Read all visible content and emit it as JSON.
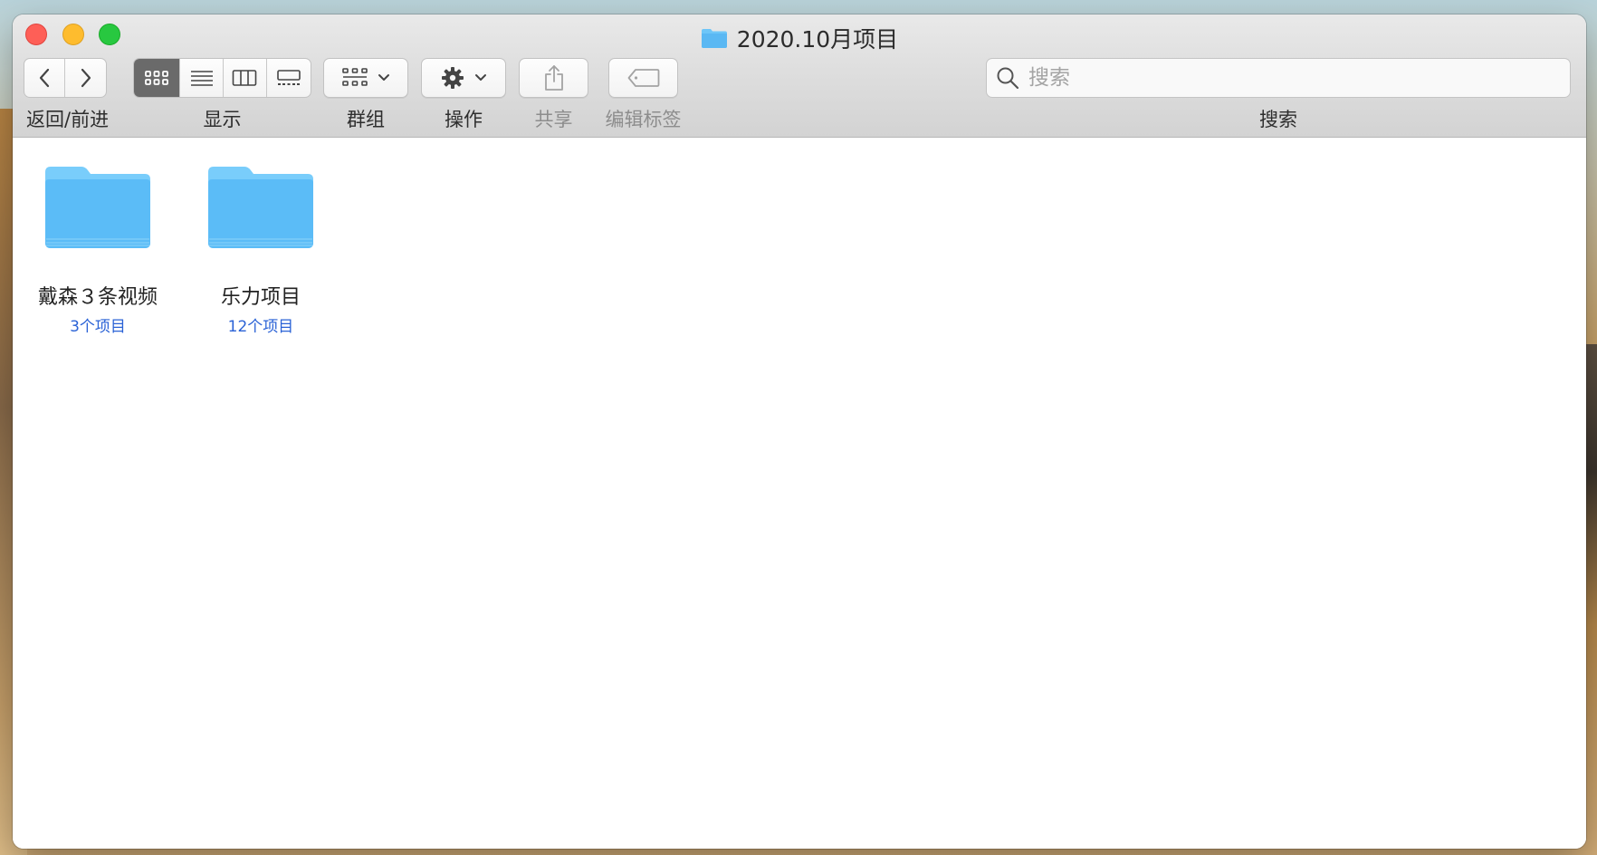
{
  "window": {
    "title": "2020.10月项目",
    "title_icon": "folder-icon"
  },
  "toolbar": {
    "back_forward_label": "返回/前进",
    "view_label": "显示",
    "group_label": "群组",
    "action_label": "操作",
    "share_label": "共享",
    "tags_label": "编辑标签",
    "search_label": "搜索",
    "search_placeholder": "搜索",
    "active_view": "icon-view"
  },
  "items": [
    {
      "name": "戴森３条视频",
      "count": "3个项目"
    },
    {
      "name": "乐力项目",
      "count": "12个项目"
    }
  ],
  "colors": {
    "folder_blue": "#5bbcf7",
    "count_blue": "#2a62d6",
    "close": "#fe5f57",
    "minimize": "#febc2e",
    "zoom": "#28c840"
  }
}
